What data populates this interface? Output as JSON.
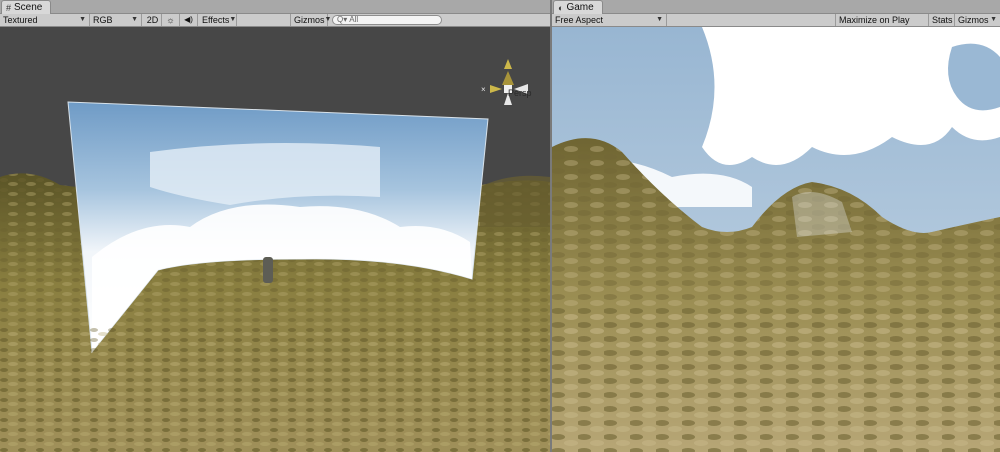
{
  "scene": {
    "tab_label": "Scene",
    "tab_icon": "scene-icon",
    "toolbar": {
      "shading_mode": "Textured",
      "render_mode": "RGB",
      "mode_2d": "2D",
      "lighting_icon": "sun-icon",
      "audio_icon": "speaker-icon",
      "effects_label": "Effects",
      "gizmos_label": "Gizmos",
      "search_placeholder": "All",
      "search_prefix": "Q▾"
    },
    "projection_label": "Persp"
  },
  "game": {
    "tab_label": "Game",
    "tab_icon": "game-controller-icon",
    "toolbar": {
      "aspect": "Free Aspect",
      "maximize_label": "Maximize on Play",
      "stats_label": "Stats",
      "gizmos_label": "Gizmos"
    }
  },
  "colors": {
    "editor_bg": "#c2c2c2",
    "scene_sky": "#464646",
    "sky_blue": "#8cb4d8",
    "terrain": "#8a7f3e"
  }
}
